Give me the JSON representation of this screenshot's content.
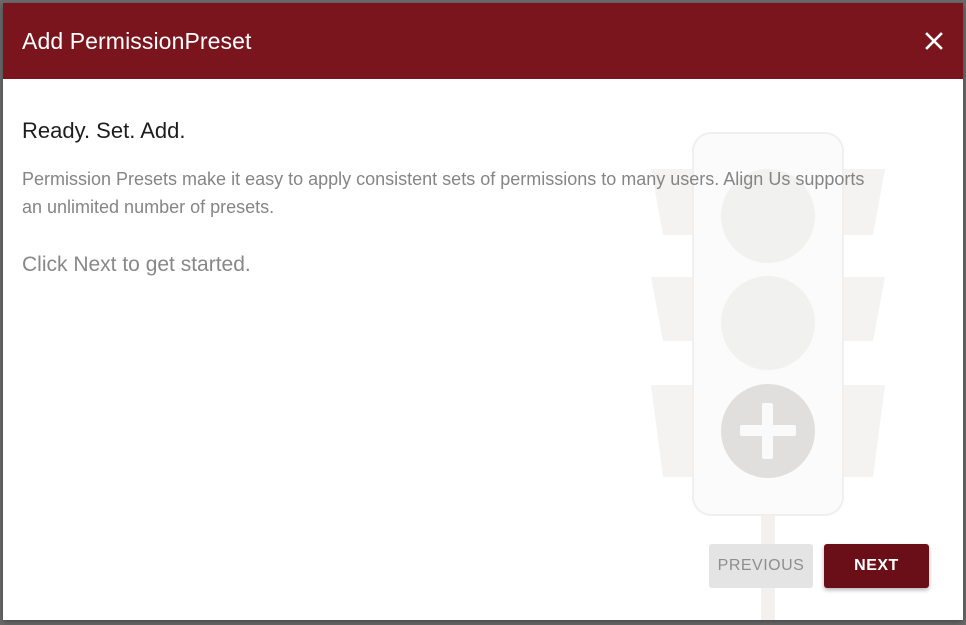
{
  "dialog": {
    "title": "Add PermissionPreset",
    "close_icon": "close-icon",
    "heading": "Ready. Set. Add.",
    "description": "Permission Presets make it easy to apply consistent sets of permissions to many users. Align Us supports an unlimited number of presets.",
    "cta": "Click Next to get started.",
    "buttons": {
      "previous_label": "PREVIOUS",
      "previous_enabled": false,
      "next_label": "NEXT"
    },
    "illustration": "traffic-light-plus-icon"
  },
  "colors": {
    "header_bg": "#7a141d",
    "primary_button": "#6a0f17",
    "disabled_button": "#e4e4e4",
    "overlay": "#6b6b6b"
  }
}
